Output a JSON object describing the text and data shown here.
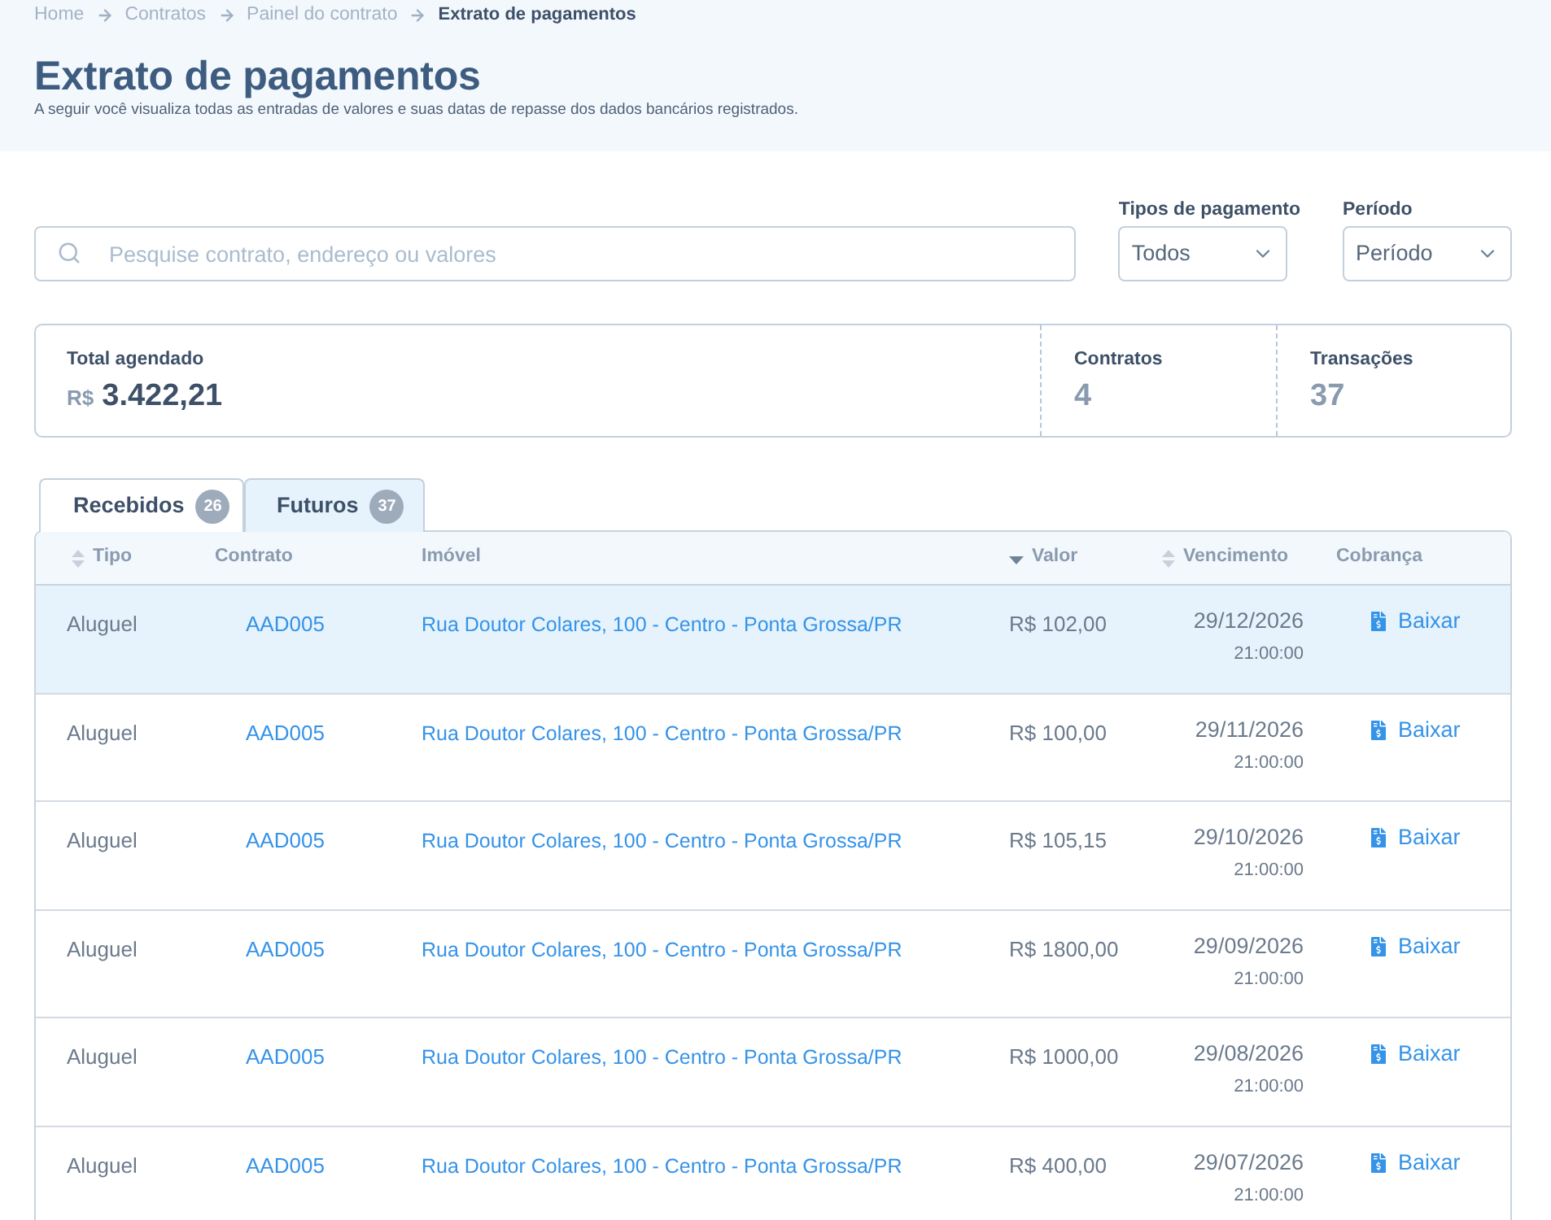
{
  "breadcrumb": [
    {
      "label": "Home",
      "current": false
    },
    {
      "label": "Contratos",
      "current": false
    },
    {
      "label": "Painel do contrato",
      "current": false
    },
    {
      "label": "Extrato de pagamentos",
      "current": true
    }
  ],
  "page": {
    "title": "Extrato de pagamentos",
    "subtitle": "A seguir você visualiza todas as entradas de valores e suas datas de repasse dos dados bancários registrados."
  },
  "filters": {
    "search": {
      "placeholder": "Pesquise contrato, endereço ou valores"
    },
    "selects": [
      {
        "label": "Tipos de pagamento",
        "value": "Todos"
      },
      {
        "label": "Período",
        "value": "Período"
      }
    ]
  },
  "summary": {
    "total": {
      "label": "Total agendado",
      "currency": "R$",
      "value": "3.422,21"
    },
    "stats": [
      {
        "label": "Contratos",
        "value": "4"
      },
      {
        "label": "Transações",
        "value": "37"
      }
    ]
  },
  "tabs": [
    {
      "label": "Recebidos",
      "count": "26",
      "selected": false
    },
    {
      "label": "Futuros",
      "count": "37",
      "selected": true
    }
  ],
  "table": {
    "columns": [
      {
        "label": "Tipo",
        "kind": "sortable"
      },
      {
        "label": "Contrato",
        "kind": "plain"
      },
      {
        "label": "Imóvel",
        "kind": "plain"
      },
      {
        "label": "Valor",
        "kind": "descending"
      },
      {
        "label": "Vencimento",
        "kind": "sortable"
      },
      {
        "label": "Cobrança",
        "kind": "plain"
      }
    ],
    "rows": [
      {
        "type": "Aluguel",
        "contract": "AAD005",
        "property": "Rua Doutor Colares, 100 - Centro - Ponta Grossa/PR",
        "amount": "R$ 102,00",
        "due_date": "29/12/2026",
        "due_time": "21:00:00",
        "action": "Baixar",
        "selected": true
      },
      {
        "type": "Aluguel",
        "contract": "AAD005",
        "property": "Rua Doutor Colares, 100 - Centro - Ponta Grossa/PR",
        "amount": "R$ 100,00",
        "due_date": "29/11/2026",
        "due_time": "21:00:00",
        "action": "Baixar",
        "selected": false
      },
      {
        "type": "Aluguel",
        "contract": "AAD005",
        "property": "Rua Doutor Colares, 100 - Centro - Ponta Grossa/PR",
        "amount": "R$ 105,15",
        "due_date": "29/10/2026",
        "due_time": "21:00:00",
        "action": "Baixar",
        "selected": false
      },
      {
        "type": "Aluguel",
        "contract": "AAD005",
        "property": "Rua Doutor Colares, 100 - Centro - Ponta Grossa/PR",
        "amount": "R$ 1800,00",
        "due_date": "29/09/2026",
        "due_time": "21:00:00",
        "action": "Baixar",
        "selected": false
      },
      {
        "type": "Aluguel",
        "contract": "AAD005",
        "property": "Rua Doutor Colares, 100 - Centro - Ponta Grossa/PR",
        "amount": "R$ 1000,00",
        "due_date": "29/08/2026",
        "due_time": "21:00:00",
        "action": "Baixar",
        "selected": false
      },
      {
        "type": "Aluguel",
        "contract": "AAD005",
        "property": "Rua Doutor Colares, 100 - Centro - Ponta Grossa/PR",
        "amount": "R$ 400,00",
        "due_date": "29/07/2026",
        "due_time": "21:00:00",
        "action": "Baixar",
        "selected": false
      }
    ]
  }
}
